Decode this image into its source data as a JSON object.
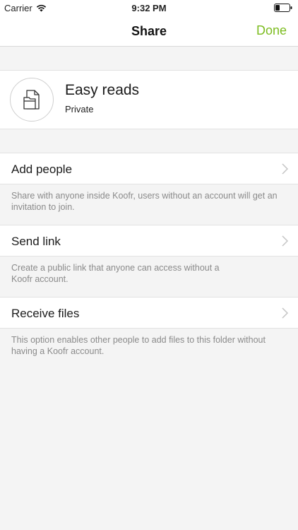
{
  "status_bar": {
    "carrier": "Carrier",
    "time": "9:32 PM",
    "wifi_icon": "wifi-icon",
    "battery_icon": "battery-icon"
  },
  "nav": {
    "title": "Share",
    "done_label": "Done"
  },
  "folder": {
    "name": "Easy reads",
    "privacy": "Private",
    "icon": "folder-file-icon"
  },
  "options": [
    {
      "label": "Add people",
      "description": "Share with anyone inside Koofr, users without an account will get an invitation to join."
    },
    {
      "label": "Send link",
      "description": "Create a public link that anyone can access without a Koofr account."
    },
    {
      "label": "Receive files",
      "description": "This option enables other people to add files to this folder without having a Koofr account."
    }
  ],
  "colors": {
    "accent": "#7cbc1f",
    "background": "#f4f4f4",
    "description_text": "#8a8a8a"
  }
}
